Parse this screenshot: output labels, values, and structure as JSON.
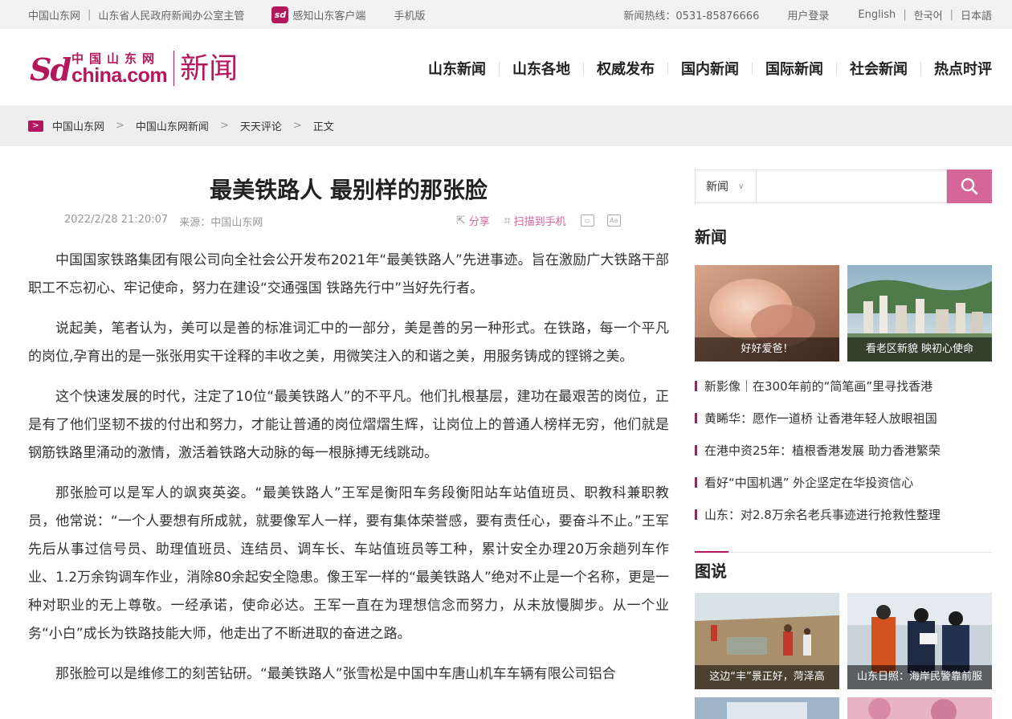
{
  "topbar": {
    "site": "中国山东网",
    "host": "山东省人民政府新闻办公室主管",
    "app": "感知山东客户端",
    "app_icon": "sd",
    "mobile": "手机版",
    "hotline": "新闻热线：0531-85876666",
    "login": "用户登录",
    "langs": [
      "English",
      "한국어",
      "日本語"
    ]
  },
  "logo": {
    "sd": "Sd",
    "cn": "中国山东网",
    "domain": "china.com",
    "section": "新闻"
  },
  "nav": [
    "山东新闻",
    "山东各地",
    "权威发布",
    "国内新闻",
    "国际新闻",
    "社会新闻",
    "热点时评"
  ],
  "breadcrumb": [
    "中国山东网",
    "中国山东网新闻",
    "天天评论",
    "正文"
  ],
  "article": {
    "title": "最美铁路人 最别样的那张脸",
    "date": "2022/2/28 21:20:07",
    "source": "来源：中国山东网",
    "share": "分享",
    "scan": "扫描到手机",
    "paragraphs": [
      "中国国家铁路集团有限公司向全社会公开发布2021年“最美铁路人”先进事迹。旨在激励广大铁路干部职工不忘初心、牢记使命，努力在建设“交通强国 铁路先行中”当好先行者。",
      "说起美，笔者认为，美可以是善的标准词汇中的一部分，美是善的另一种形式。在铁路，每一个平凡的岗位,孕育出的是一张张用实干诠释的丰收之美，用微笑注入的和谐之美，用服务铸成的铿锵之美。",
      "这个快速发展的时代，注定了10位“最美铁路人”的不平凡。他们扎根基层，建功在最艰苦的岗位，正是有了他们坚韧不拔的付出和努力，才能让普通的岗位熠熠生辉，让岗位上的普通人榜样无穷，他们就是钢筋铁路里涌动的激情，激活着铁路大动脉的每一根脉搏无线跳动。",
      "那张脸可以是军人的飒爽英姿。“最美铁路人”王军是衡阳车务段衡阳站车站值班员、职教科兼职教员，他常说：“一个人要想有所成就，就要像军人一样，要有集体荣誉感，要有责任心，要奋斗不止。”王军先后从事过信号员、助理值班员、连结员、调车长、车站值班员等工种，累计安全办理20万余趟列车作业、1.2万余钩调车作业，消除80余起安全隐患。像王军一样的“最美铁路人”绝对不止是一个名称，更是一种对职业的无上尊敬。一经承诺，使命必达。王军一直在为理想信念而努力，从未放慢脚步。从一个业务“小白”成长为铁路技能大师，他走出了不断进取的奋进之路。",
      "那张脸可以是维修工的刻苦钻研。“最美铁路人”张雪松是中国中车唐山机车车辆有限公司铝合"
    ]
  },
  "sidebar": {
    "search_select": "新闻",
    "search_value": "",
    "news_title": "新闻",
    "news_thumbs": [
      "好好爱爸！",
      "看老区新貌 映初心使命"
    ],
    "news_list": [
      "新影像｜在300年前的“简笔画”里寻找香港",
      "黄睎华：愿作一道桥 让香港年轻人放眼祖国",
      "在港中资25年：植根香港发展 助力香港繁荣",
      "看好“中国机遇” 外企坚定在华投资信心",
      "山东：对2.8万余名老兵事迹进行抢救性整理"
    ],
    "pics_title": "图说",
    "pic_thumbs": [
      "这边“丰”景正好，菏泽高",
      "山东日照：海岸民警靠前服"
    ]
  },
  "colors": {
    "brand": "#b3185c",
    "accent": "#d4669a"
  }
}
